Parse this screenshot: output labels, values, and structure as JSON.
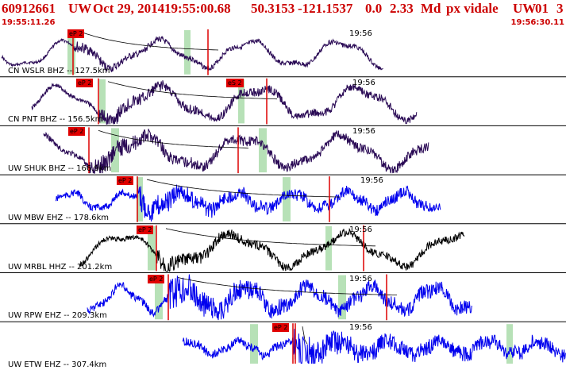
{
  "header": {
    "event_id": "60912661",
    "network": "UW",
    "date": "Oct 29, 2014",
    "time": "19:55:00.68",
    "latitude": "50.3153",
    "longitude": "-121.1537",
    "depth": "0.0",
    "magnitude": "2.33",
    "mag_type": "Md",
    "author": "px vidale",
    "source": "UW",
    "version": "01",
    "quality": "3",
    "start_time": "19:55:11.26",
    "end_time": "19:56:30.11"
  },
  "colors": {
    "title": "#cc0000",
    "black_trace": "#000000",
    "purple_trace": "#2a0a55",
    "blue_trace": "#0000ee",
    "pick_fill": "#e00000",
    "pick_line": "#dd0000",
    "window_fill": "#b7e1b7"
  },
  "traces": [
    {
      "label": "CN WSLR BHZ -- 127.5km",
      "pick_label": "eP 2",
      "minute_label": "19:56",
      "color": "purple"
    },
    {
      "label": "CN PNT BHZ -- 156.5km",
      "pick_label": "eP 2",
      "pick2_label": "eS 2",
      "minute_label": "19:56",
      "color": "purple"
    },
    {
      "label": "UW SHUK BHZ -- 166.9km",
      "pick_label": "eP 2",
      "minute_label": "19:56",
      "color": "purple"
    },
    {
      "label": "UW MBW EHZ -- 178.6km",
      "pick_label": "eP 2",
      "minute_label": "19:56",
      "color": "blue"
    },
    {
      "label": "UW MRBL HHZ -- 201.2km",
      "pick_label": "eP 2",
      "minute_label": "19:56",
      "color": "black"
    },
    {
      "label": "UW RPW EHZ -- 209.3km",
      "pick_label": "eP 2",
      "minute_label": "19:56",
      "color": "blue"
    },
    {
      "label": "UW ETW EHZ -- 307.4km",
      "pick_label": "eP 2",
      "minute_label": "19:56",
      "color": "blue"
    }
  ]
}
